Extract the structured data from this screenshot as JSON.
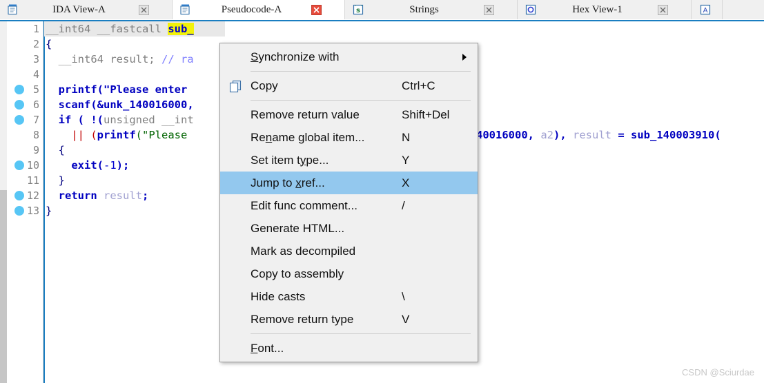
{
  "tabs": [
    {
      "id": "ida-view-a",
      "label": "IDA View-A",
      "icon": "document-blue-icon",
      "active": false,
      "close_icon": "close-gray-icon"
    },
    {
      "id": "pseudocode-a",
      "label": "Pseudocode-A",
      "icon": "document-blue-icon",
      "active": true,
      "close_icon": "close-red-icon"
    },
    {
      "id": "strings",
      "label": "Strings",
      "icon": "strings-green-icon",
      "active": false,
      "close_icon": "close-gray-icon"
    },
    {
      "id": "hex-view-1",
      "label": "Hex View-1",
      "icon": "hex-view-icon",
      "active": false,
      "close_icon": "close-gray-icon"
    },
    {
      "id": "extra",
      "label": "",
      "icon": "structures-icon",
      "active": false,
      "close_icon": ""
    }
  ],
  "editor": {
    "lines": [
      {
        "num": "1",
        "breakpoint": false,
        "current": true
      },
      {
        "num": "2",
        "breakpoint": false,
        "current": false
      },
      {
        "num": "3",
        "breakpoint": false,
        "current": false
      },
      {
        "num": "4",
        "breakpoint": false,
        "current": false
      },
      {
        "num": "5",
        "breakpoint": true,
        "current": false
      },
      {
        "num": "6",
        "breakpoint": true,
        "current": false
      },
      {
        "num": "7",
        "breakpoint": true,
        "current": false
      },
      {
        "num": "8",
        "breakpoint": false,
        "current": false
      },
      {
        "num": "9",
        "breakpoint": false,
        "current": false
      },
      {
        "num": "10",
        "breakpoint": true,
        "current": false
      },
      {
        "num": "11",
        "breakpoint": false,
        "current": false
      },
      {
        "num": "12",
        "breakpoint": true,
        "current": false
      },
      {
        "num": "13",
        "breakpoint": true,
        "current": false
      }
    ],
    "code": {
      "l1_a": "__int64 __fastcall ",
      "l1_hl": "sub_",
      "l2": "{",
      "l3_a": "  __int64 result; ",
      "l3_cmt": "// ra",
      "l5": "  printf(\"Please enter",
      "l6_a": "  scanf(&",
      "l6_b": "unk_140016000",
      "l6_c": ",",
      "l7_a": "  if ( !(",
      "l7_b": "unsigned __int",
      "l8_a": "    || (",
      "l8_b": "printf",
      "l8_c": "(\"Please",
      "l8_right_a": "40016000",
      "l8_right_b": ", ",
      "l8_right_c": "a2",
      "l8_right_d": "), ",
      "l8_right_e": "result",
      "l8_right_f": " = ",
      "l8_right_g": "sub_140003910",
      "l8_right_h": "(",
      "l9": "  {",
      "l10_a": "    exit",
      "l10_b": "(",
      "l10_c": "-1",
      "l10_d": ");",
      "l11": "  }",
      "l12_a": "  return ",
      "l12_b": "result",
      "l12_c": ";",
      "l13": "}"
    }
  },
  "context_menu": {
    "items": [
      {
        "id": "synchronize-with",
        "label": "Synchronize with",
        "label_pre": "S",
        "label_post": "ynchronize with",
        "shortcut": "",
        "submenu": true,
        "selected": false,
        "icon": "",
        "sep_after": true
      },
      {
        "id": "copy",
        "label": "Copy",
        "label_pre": "",
        "label_post": "Copy",
        "shortcut": "Ctrl+C",
        "submenu": false,
        "selected": false,
        "icon": "copy-icon",
        "sep_after": true
      },
      {
        "id": "remove-return-value",
        "label": "Remove return value",
        "label_pre": "",
        "label_post": "Remove return value",
        "shortcut": "Shift+Del",
        "submenu": false,
        "selected": false,
        "icon": "",
        "sep_after": false
      },
      {
        "id": "rename-global-item",
        "label": "Rename global item...",
        "label_pre": "Re",
        "label_post": "name global item...",
        "shortcut": "N",
        "submenu": false,
        "selected": false,
        "icon": "",
        "sep_after": false
      },
      {
        "id": "set-item-type",
        "label": "Set item type...",
        "label_pre": "Set item t",
        "label_post": "ype...",
        "shortcut": "Y",
        "submenu": false,
        "selected": false,
        "icon": "",
        "sep_after": false
      },
      {
        "id": "jump-to-xref",
        "label": "Jump to xref...",
        "label_pre": "Jump to ",
        "label_post": "xref...",
        "shortcut": "X",
        "submenu": false,
        "selected": true,
        "icon": "",
        "sep_after": false
      },
      {
        "id": "edit-func-comment",
        "label": "Edit func comment...",
        "label_pre": "",
        "label_post": "Edit func comment...",
        "shortcut": "/",
        "submenu": false,
        "selected": false,
        "icon": "",
        "sep_after": false
      },
      {
        "id": "generate-html",
        "label": "Generate HTML...",
        "label_pre": "",
        "label_post": "Generate HTML...",
        "shortcut": "",
        "submenu": false,
        "selected": false,
        "icon": "",
        "sep_after": false
      },
      {
        "id": "mark-as-decompiled",
        "label": "Mark as decompiled",
        "label_pre": "",
        "label_post": "Mark as decompiled",
        "shortcut": "",
        "submenu": false,
        "selected": false,
        "icon": "",
        "sep_after": false
      },
      {
        "id": "copy-to-assembly",
        "label": "Copy to assembly",
        "label_pre": "",
        "label_post": "Copy to assembly",
        "shortcut": "",
        "submenu": false,
        "selected": false,
        "icon": "",
        "sep_after": false
      },
      {
        "id": "hide-casts",
        "label": "Hide casts",
        "label_pre": "",
        "label_post": "Hide casts",
        "shortcut": "\\",
        "submenu": false,
        "selected": false,
        "icon": "",
        "sep_after": false
      },
      {
        "id": "remove-return-type",
        "label": "Remove return type",
        "label_pre": "",
        "label_post": "Remove return type",
        "shortcut": "V",
        "submenu": false,
        "selected": false,
        "icon": "",
        "sep_after": true
      },
      {
        "id": "font",
        "label": "Font...",
        "label_pre": "F",
        "label_post": "ont...",
        "shortcut": "",
        "submenu": false,
        "selected": false,
        "icon": "",
        "sep_after": false
      }
    ]
  },
  "watermark": {
    "text": "CSDN @Sciurdae"
  },
  "colors": {
    "accent": "#1a7ec1",
    "menu_selection": "#93c8ee",
    "highlight_yellow": "#f2f20a",
    "breakpoint": "#57c6f5",
    "string_green": "#006400",
    "keyword_blue": "#0000c0",
    "comment_blue": "#8080ff",
    "type_gray": "#808080",
    "menu_bg": "#f0f0f0",
    "tabbar_bg": "#f0f0f0"
  }
}
